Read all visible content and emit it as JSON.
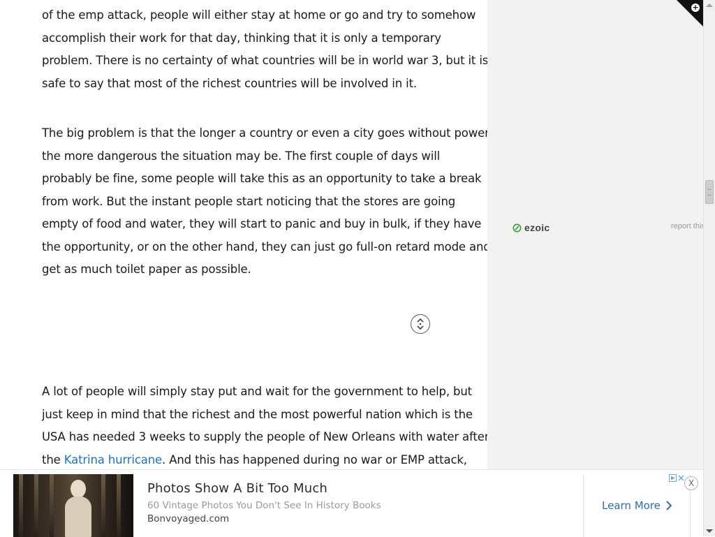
{
  "article": {
    "paragraph_1": [
      "of the emp attack, people will either stay at home or go and try to somehow",
      "accomplish their work for that day, thinking that it is only a temporary",
      "problem. There is no certainty of what countries will be in world war 3, but it is",
      "safe to say that most of the richest countries will be involved in it."
    ],
    "paragraph_2": [
      "The big problem is that the longer a country or even a city goes without power",
      "the more dangerous the situation may be. The first couple of days will",
      "probably be fine, some people will take this as an opportunity to take a break",
      "from work. But the instant people start noticing that the stores are going",
      "empty of food and water, they will start to panic and buy in bulk, if they have",
      "the opportunity, or on the other hand, they can just go full-on retard mode and",
      "get as much toilet paper as possible."
    ],
    "paragraph_3": [
      "A lot of people will simply stay put and wait for the government to help, but",
      "just keep in mind that the richest and the most powerful nation which is the",
      "USA has needed 3 weeks to supply the people of New Orleans with water after"
    ],
    "paragraph_3_last": {
      "before": "the ",
      "link": "Katrina hurricane",
      "after": ". And this has happened during no war or EMP attack,"
    },
    "scroll_toggle_icon": "up-down-chevrons-icon"
  },
  "sidebar": {
    "ezoic_label": "ezoic",
    "report_label": "report this ad",
    "corner_icon": "plus-icon"
  },
  "ad": {
    "title": "Photos Show A Bit Too Much",
    "subtitle": "60 Vintage Photos You Don't See In History Books",
    "source": "Bonvoyaged.com",
    "cta": "Learn More",
    "close": "X",
    "choices_icon": "adchoices-icon"
  },
  "colors": {
    "link": "#1a73c8",
    "cta": "#2a6db5",
    "sidebar_bg": "#f2f2f2",
    "ezoic_green": "#3a9a3a"
  }
}
